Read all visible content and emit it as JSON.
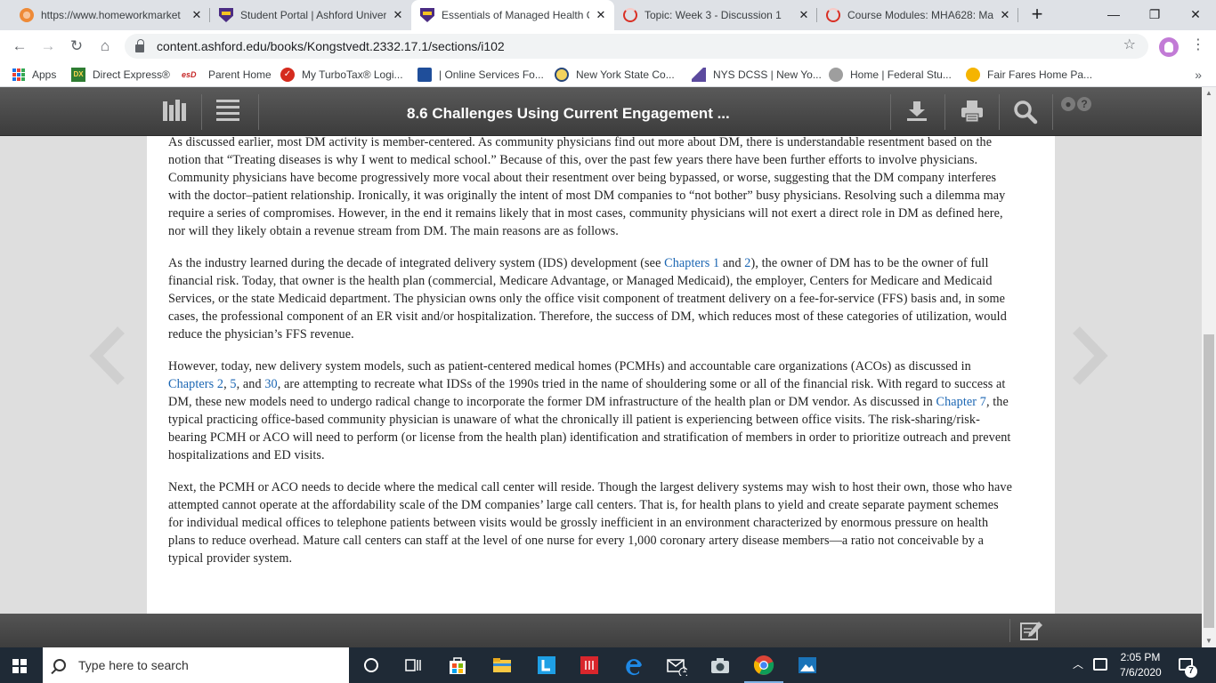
{
  "browser": {
    "tabs": [
      {
        "title": "https://www.homeworkmarket",
        "active": false
      },
      {
        "title": "Student Portal | Ashford Univer",
        "active": false
      },
      {
        "title": "Essentials of Managed Health C",
        "active": true
      },
      {
        "title": "Topic: Week 3 - Discussion 1",
        "active": false
      },
      {
        "title": "Course Modules: MHA628: Ma",
        "active": false
      }
    ],
    "tab_close": "✕",
    "new_tab": "+",
    "window": {
      "minimize": "—",
      "restore": "❐",
      "close": "✕"
    },
    "nav": {
      "back": "←",
      "forward": "→",
      "reload": "↻",
      "home": "⌂"
    },
    "url": "content.ashford.edu/books/Kongstvedt.2332.17.1/sections/i102",
    "star": "☆",
    "menu": "⋮",
    "bookmarks": [
      {
        "label": "Apps"
      },
      {
        "label": "Direct Express®",
        "icon_text": "DX"
      },
      {
        "label": "Parent Home",
        "icon_text": "esD"
      },
      {
        "label": "My TurboTax® Logi..."
      },
      {
        "label": "| Online Services Fo..."
      },
      {
        "label": "New York State Co..."
      },
      {
        "label": "NYS DCSS | New Yo..."
      },
      {
        "label": "Home | Federal Stu..."
      },
      {
        "label": "Fair Fares Home Pa..."
      }
    ],
    "bookmarks_more": "»"
  },
  "reader": {
    "title": "8.6 Challenges Using Current Engagement ...",
    "user_glyph": "●",
    "help_glyph": "?"
  },
  "content": {
    "paragraphs": [
      [
        {
          "t": "As discussed earlier, most DM activity is member-centered. As community physicians find out more about DM, there is understandable resentment based on the notion that “Treating diseases is why I went to medical school.” Because of this, over the past few years there have been further efforts to involve physicians. Community physicians have become progressively more vocal about their resentment over being bypassed, or worse, suggesting that the DM company interferes with the doctor–patient relationship. Ironically, it was originally the intent of most DM companies to “not bother” busy physicians. Resolving such a dilemma may require a series of compromises. However, in the end it remains likely that in most cases, community physicians will not exert a direct role in DM as defined here, nor will they likely obtain a revenue stream from DM. The main reasons are as follows."
        }
      ],
      [
        {
          "t": "As the industry learned during the decade of integrated delivery system (IDS) development (see "
        },
        {
          "t": "Chapters 1",
          "link": true
        },
        {
          "t": " and "
        },
        {
          "t": "2",
          "link": true
        },
        {
          "t": "), the owner of DM has to be the owner of full financial risk. Today, that owner is the health plan (commercial, Medicare Advantage, or Managed Medicaid), the employer, Centers for Medicare and Medicaid Services, or the state Medicaid department. The physician owns only the office visit component of treatment delivery on a fee-for-service (FFS) basis and, in some cases, the professional component of an ER visit and/or hospitalization. Therefore, the success of DM, which reduces most of these categories of utilization, would reduce the physician’s FFS revenue."
        }
      ],
      [
        {
          "t": "However, today, new delivery system models, such as patient-centered medical homes (PCMHs) and accountable care organizations (ACOs) as discussed in "
        },
        {
          "t": "Chapters 2",
          "link": true
        },
        {
          "t": ", "
        },
        {
          "t": "5",
          "link": true
        },
        {
          "t": ", and "
        },
        {
          "t": "30",
          "link": true
        },
        {
          "t": ", are attempting to recreate what IDSs of the 1990s tried in the name of shouldering some or all of the financial risk. With regard to success at DM, these new models need to undergo radical change to incorporate the former DM infrastructure of the health plan or DM vendor. As discussed in "
        },
        {
          "t": "Chapter 7",
          "link": true
        },
        {
          "t": ", the typical practicing office-based community physician is unaware of what the chronically ill patient is experiencing between office visits. The risk-sharing/risk-bearing PCMH or ACO will need to perform (or license from the health plan) identification and stratification of members in order to prioritize outreach and prevent hospitalizations and ED visits."
        }
      ],
      [
        {
          "t": "Next, the PCMH or ACO needs to decide where the medical call center will reside. Though the largest delivery systems may wish to host their own, those who have attempted cannot operate at the affordability scale of the DM companies’ large call centers. That is, for health plans to yield and create separate payment schemes for individual medical offices to telephone patients between visits would be grossly inefficient in an environment characterized by enormous pressure on health plans to reduce overhead. Mature call centers can staff at the level of one nurse for every 1,000 coronary artery disease members—a ratio not conceivable by a typical provider system."
        }
      ]
    ]
  },
  "scrollbar": {
    "up": "▲",
    "down": "▼"
  },
  "taskbar": {
    "search_placeholder": "Type here to search",
    "mail_badge": "1",
    "tray_up": "︿",
    "time": "2:05 PM",
    "date": "7/6/2020",
    "notification_count": "7"
  },
  "colors": {
    "link": "#1b66b3",
    "reader_bar": "#474747",
    "taskbar": "#1f2a36"
  }
}
